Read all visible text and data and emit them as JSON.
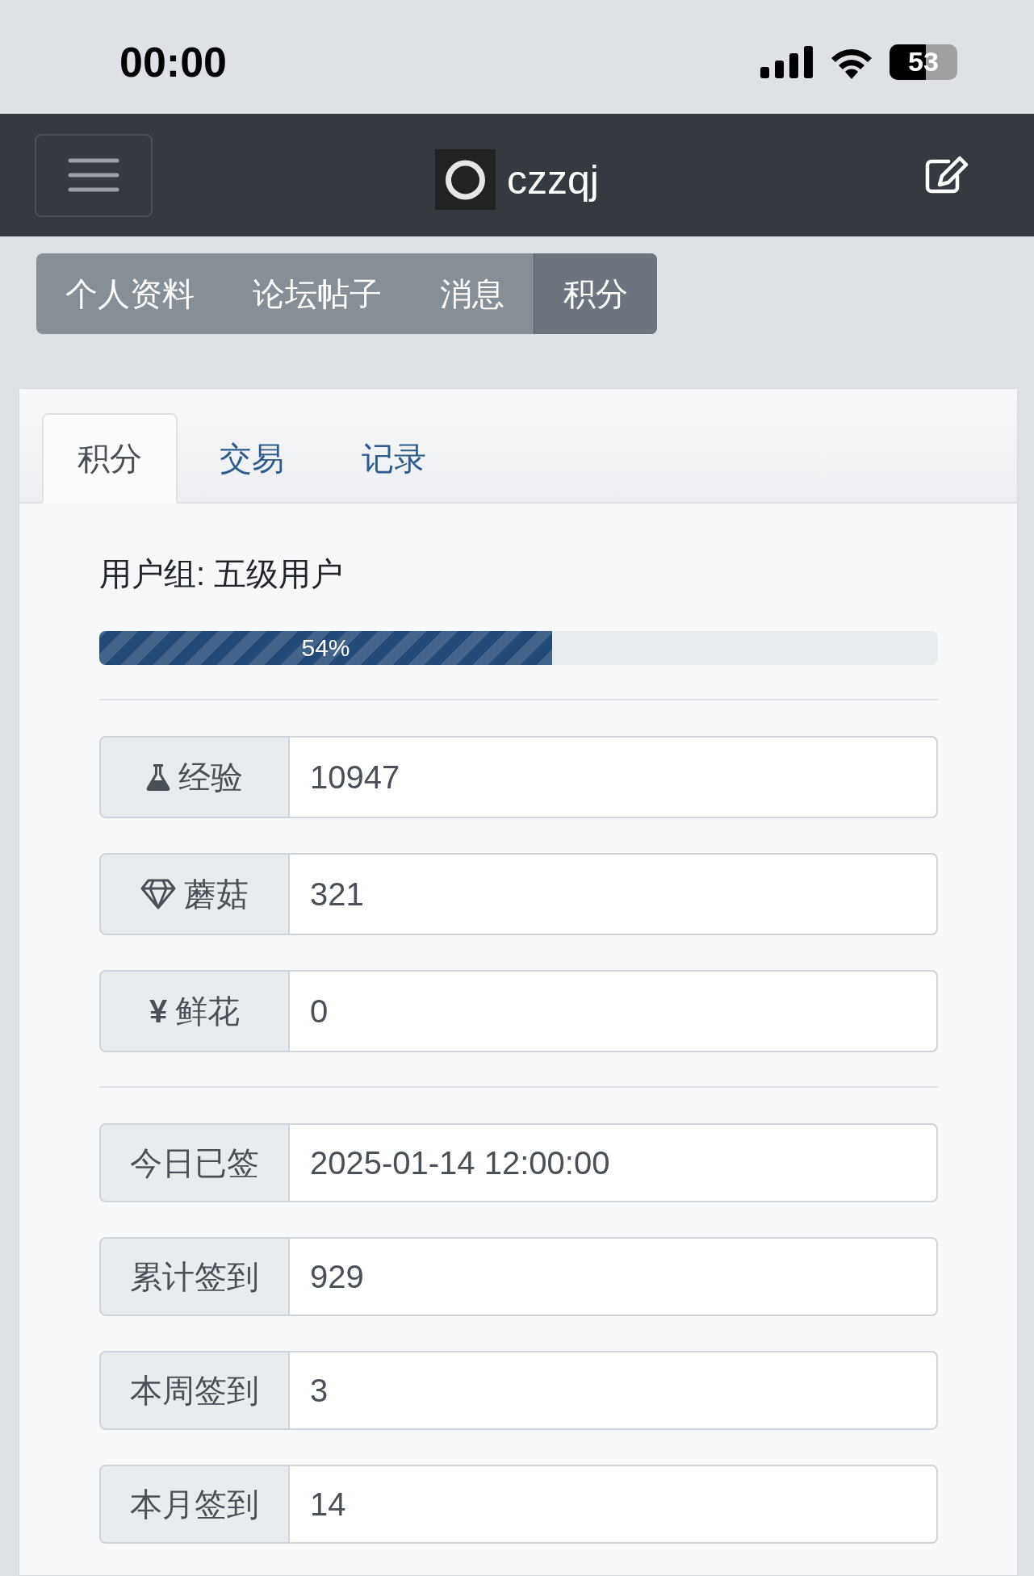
{
  "status_bar": {
    "time": "00:00",
    "battery": "53"
  },
  "navbar": {
    "title": "czzqj"
  },
  "nav_pills": [
    {
      "label": "个人资料",
      "selected": false
    },
    {
      "label": "论坛帖子",
      "selected": false
    },
    {
      "label": "消息",
      "selected": false
    },
    {
      "label": "积分",
      "selected": true
    }
  ],
  "card_tabs": [
    {
      "label": "积分",
      "selected": true
    },
    {
      "label": "交易",
      "selected": false
    },
    {
      "label": "记录",
      "selected": false
    }
  ],
  "user_group": "用户组: 五级用户",
  "progress": {
    "level": 0.54,
    "label": "54%"
  },
  "credits": [
    {
      "kind": "flask",
      "label": "经验",
      "value": "10947"
    },
    {
      "kind": "gem",
      "label": "蘑菇",
      "value": "321"
    },
    {
      "kind": "symbol",
      "symbol": "¥",
      "label": "鲜花",
      "value": "0"
    }
  ],
  "signins": [
    {
      "label": "今日已签",
      "value": "2025-01-14 12:00:00"
    },
    {
      "label": "累计签到",
      "value": "929"
    },
    {
      "label": "本周签到",
      "value": "3"
    },
    {
      "label": "本月签到",
      "value": "14"
    }
  ]
}
